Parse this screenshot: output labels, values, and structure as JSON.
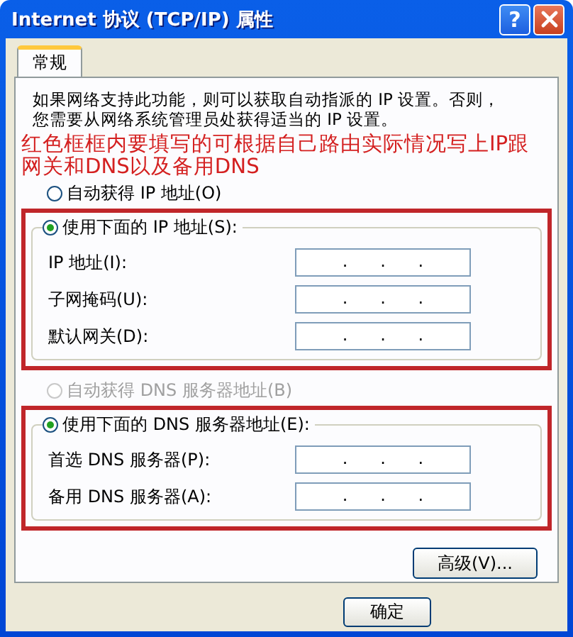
{
  "window": {
    "title": "Internet 协议 (TCP/IP) 属性",
    "title_buttons": [
      {
        "kind": "help",
        "label": "?"
      },
      {
        "kind": "close"
      }
    ]
  },
  "tabs": [
    {
      "label": "常规",
      "selected": true
    }
  ],
  "intro": [
    "如果网络支持此功能，则可以获取自动指派的 IP 设置。否则，",
    "您需要从网络系统管理员处获得适当的 IP 设置。"
  ],
  "annotation": "红色框框内要填写的可根据自己路由实际情况写上IP跟网关和DNS以及备用DNS",
  "ip_section": {
    "auto_option": {
      "label": "自动获得 IP 地址(O)",
      "selected": false,
      "disabled": false
    },
    "manual_option": {
      "label": "使用下面的 IP 地址(S):",
      "selected": true,
      "disabled": false
    },
    "fields": [
      {
        "label": "IP 地址(I):",
        "value": ".      .      ."
      },
      {
        "label": "子网掩码(U):",
        "value": ".      .      ."
      },
      {
        "label": "默认网关(D):",
        "value": ".      .      ."
      }
    ]
  },
  "dns_section": {
    "auto_option": {
      "label": "自动获得 DNS 服务器地址(B)",
      "selected": false,
      "disabled": true
    },
    "manual_option": {
      "label": "使用下面的 DNS 服务器地址(E):",
      "selected": true,
      "disabled": false
    },
    "fields": [
      {
        "label": "首选 DNS 服务器(P):",
        "value": ".      .      ."
      },
      {
        "label": "备用 DNS 服务器(A):",
        "value": ".      .      ."
      }
    ]
  },
  "advanced_button": "高级(V)...",
  "footer_buttons": [
    "确定"
  ]
}
